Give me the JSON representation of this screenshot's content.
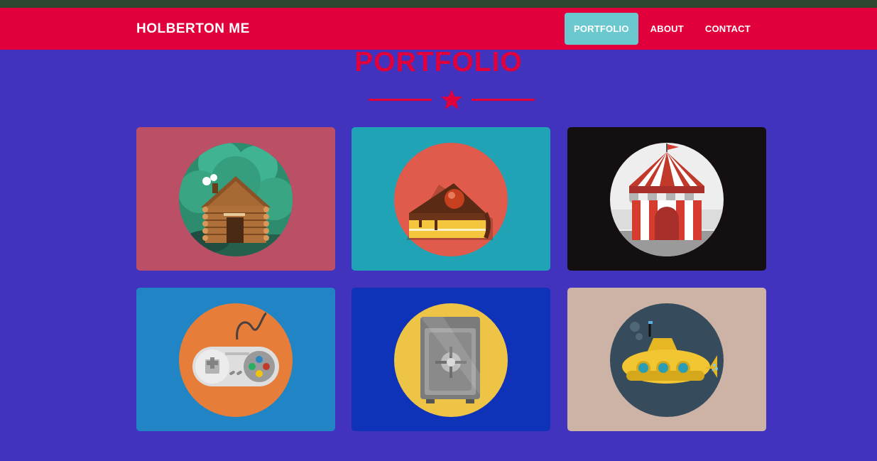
{
  "navbar": {
    "brand": "HOLBERTON ME",
    "links": [
      {
        "label": "PORTFOLIO",
        "active": true
      },
      {
        "label": "ABOUT",
        "active": false
      },
      {
        "label": "CONTACT",
        "active": false
      }
    ]
  },
  "section": {
    "title": "PORTFOLIO",
    "divider_icon": "star-icon"
  },
  "portfolio": {
    "items": [
      {
        "icon": "log-cabin-icon",
        "background": "#BA4F66",
        "circle": "#2E8C6E"
      },
      {
        "icon": "cake-slice-icon",
        "background": "#1FA3B5",
        "circle": "#E05B4B"
      },
      {
        "icon": "circus-tent-icon",
        "background": "#141011",
        "circle": "#EEEEEE"
      },
      {
        "icon": "game-controller-icon",
        "background": "#2185C5",
        "circle": "#E67E3A"
      },
      {
        "icon": "safe-icon",
        "background": "#0F33B8",
        "circle": "#EEC446"
      },
      {
        "icon": "submarine-icon",
        "background": "#CCB3A6",
        "circle": "#364B5B"
      }
    ]
  },
  "colors": {
    "accent": "#E1003B",
    "active_tab": "#6CC8CF",
    "page_bg": "#4233BE",
    "top_strip": "#2F4530"
  }
}
